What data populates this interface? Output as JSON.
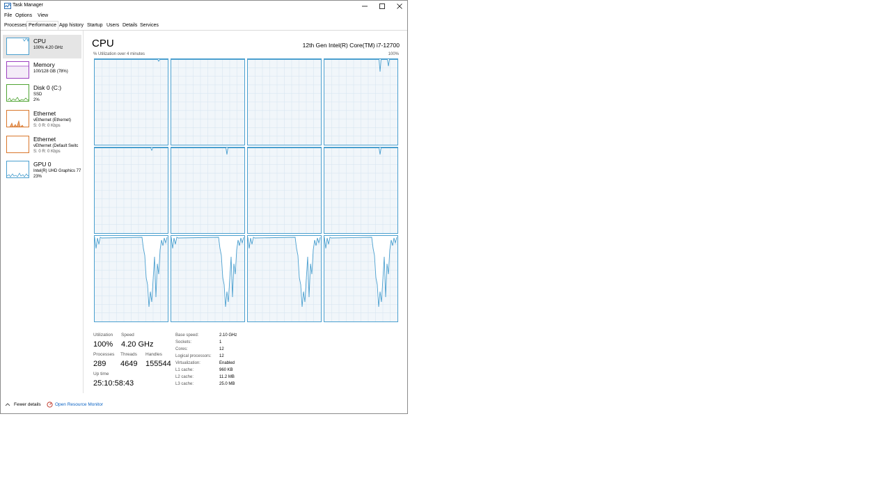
{
  "window": {
    "title": "Task Manager"
  },
  "menu": [
    "File",
    "Options",
    "View"
  ],
  "tabs": [
    "Processes",
    "Performance",
    "App history",
    "Startup",
    "Users",
    "Details",
    "Services"
  ],
  "active_tab": "Performance",
  "sidebar": [
    {
      "name": "CPU",
      "lines": [
        "100%  4.20 GHz"
      ],
      "color": "#4a9fcf"
    },
    {
      "name": "Memory",
      "lines": [
        "100/128 GB (78%)"
      ],
      "color": "#9b3fbf"
    },
    {
      "name": "Disk 0 (C:)",
      "lines": [
        "SSD",
        "2%"
      ],
      "color": "#4fa332"
    },
    {
      "name": "Ethernet",
      "lines": [
        "vEthernet (Ethernet)",
        "S: 0  R: 0 Kbps"
      ],
      "color": "#d9762b"
    },
    {
      "name": "Ethernet",
      "lines": [
        "vEthernet (Default Switc",
        "S: 0  R: 0 Kbps"
      ],
      "color": "#d9762b"
    },
    {
      "name": "GPU 0",
      "lines": [
        "Intel(R) UHD Graphics 77",
        "23%"
      ],
      "color": "#4a9fcf"
    }
  ],
  "main": {
    "title": "CPU",
    "model": "12th Gen Intel(R) Core(TM) i7-12700",
    "util_label": "% Utilization over 4 minutes",
    "max_label": "100%",
    "line_color": "#4a9fcf"
  },
  "stats": {
    "utilization_label": "Utilization",
    "utilization": "100%",
    "speed_label": "Speed",
    "speed": "4.20 GHz",
    "processes_label": "Processes",
    "processes": "289",
    "threads_label": "Threads",
    "threads": "4649",
    "handles_label": "Handles",
    "handles": "155544",
    "uptime_label": "Up time",
    "uptime": "25:10:58:43"
  },
  "specs": [
    {
      "label": "Base speed:",
      "value": "2.10 GHz"
    },
    {
      "label": "Sockets:",
      "value": "1"
    },
    {
      "label": "Cores:",
      "value": "12"
    },
    {
      "label": "Logical processors:",
      "value": "12"
    },
    {
      "label": "Virtualization:",
      "value": "Enabled"
    },
    {
      "label": "L1 cache:",
      "value": "960 KB"
    },
    {
      "label": "L2 cache:",
      "value": "11.2 MB"
    },
    {
      "label": "L3 cache:",
      "value": "25.0 MB"
    }
  ],
  "footer": {
    "fewer_details": "Fewer details",
    "open_monitor": "Open Resource Monitor"
  }
}
